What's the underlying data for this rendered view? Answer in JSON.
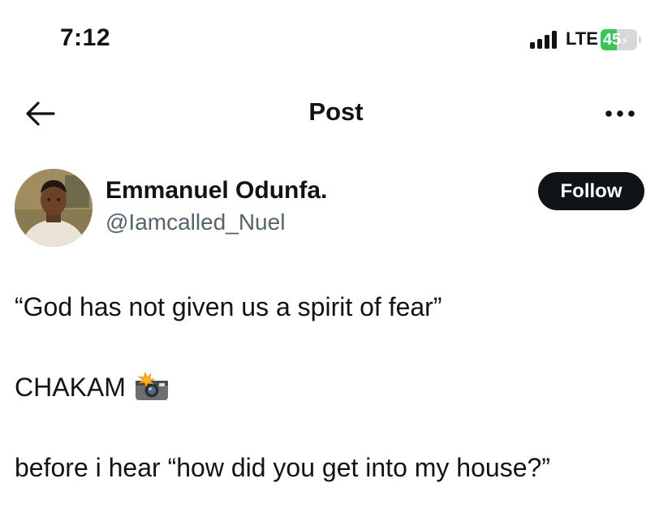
{
  "status_bar": {
    "time": "7:12",
    "network": "LTE",
    "battery": "45",
    "battery_level": 0.45
  },
  "nav": {
    "title": "Post",
    "back_icon": "arrow-left-icon",
    "more_icon": "more-horizontal-icon"
  },
  "author": {
    "name": "Emmanuel Odunfa.",
    "handle": "@Iamcalled_Nuel",
    "follow_label": "Follow"
  },
  "post": {
    "lines": [
      "“God has not given us a spirit of fear”",
      "CHAKAM",
      "before i hear “how did you get into my house?”"
    ],
    "emoji": "camera-flash-icon"
  },
  "colors": {
    "text": "#0f1419",
    "secondary": "#536471",
    "follow_bg": "#0f1419",
    "battery": "#34c759"
  }
}
